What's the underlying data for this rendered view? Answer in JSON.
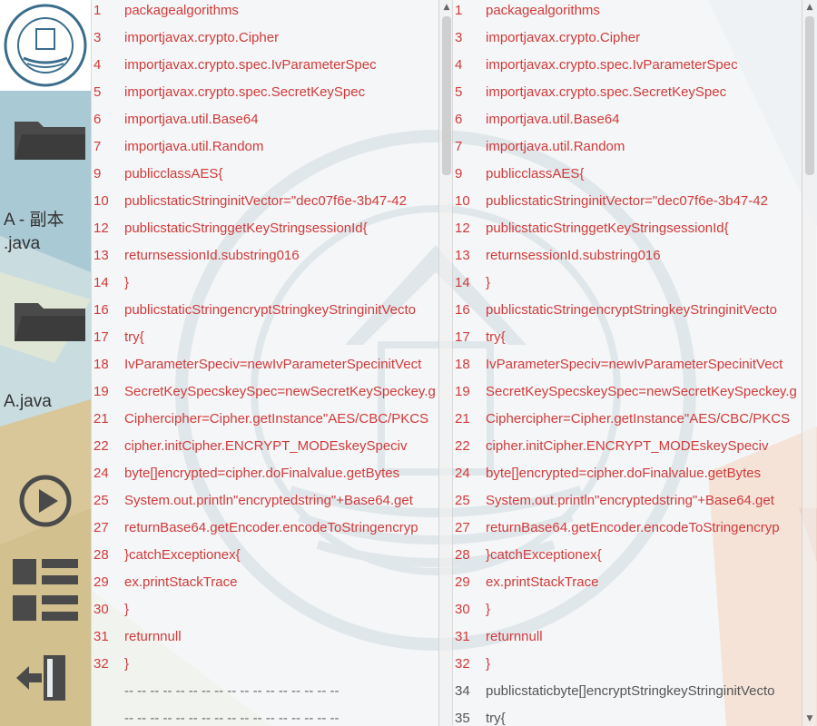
{
  "sidebar": {
    "files": [
      {
        "label_line1": "A - 副本",
        "label_line2": ".java",
        "icon": "folder-icon"
      },
      {
        "label_line1": "A.java",
        "label_line2": "",
        "icon": "folder-icon"
      }
    ],
    "tools": [
      {
        "name": "play-icon"
      },
      {
        "name": "list-view-icon"
      },
      {
        "name": "exit-icon"
      }
    ]
  },
  "left_pane": {
    "lines": [
      {
        "n": "1",
        "text": "packagealgorithms",
        "state": "diff"
      },
      {
        "n": "3",
        "text": "importjavax.crypto.Cipher",
        "state": "diff"
      },
      {
        "n": "4",
        "text": "importjavax.crypto.spec.IvParameterSpec",
        "state": "diff"
      },
      {
        "n": "5",
        "text": "importjavax.crypto.spec.SecretKeySpec",
        "state": "diff"
      },
      {
        "n": "6",
        "text": "importjava.util.Base64",
        "state": "diff"
      },
      {
        "n": "7",
        "text": "importjava.util.Random",
        "state": "diff"
      },
      {
        "n": "9",
        "text": "publicclassAES{",
        "state": "diff"
      },
      {
        "n": "10",
        "text": "publicstaticStringinitVector=\"dec07f6e-3b47-42",
        "state": "diff"
      },
      {
        "n": "12",
        "text": "publicstaticStringgetKeyStringsessionId{",
        "state": "diff"
      },
      {
        "n": "13",
        "text": "returnsessionId.substring016",
        "state": "diff"
      },
      {
        "n": "14",
        "text": "}",
        "state": "diff"
      },
      {
        "n": "16",
        "text": "publicstaticStringencryptStringkeyStringinitVecto",
        "state": "diff"
      },
      {
        "n": "17",
        "text": "try{",
        "state": "diff"
      },
      {
        "n": "18",
        "text": "IvParameterSpeciv=newIvParameterSpecinitVect",
        "state": "diff"
      },
      {
        "n": "19",
        "text": "SecretKeySpecskeySpec=newSecretKeySpeckey.g",
        "state": "diff"
      },
      {
        "n": "21",
        "text": "Ciphercipher=Cipher.getInstance\"AES/CBC/PKCS",
        "state": "diff"
      },
      {
        "n": "22",
        "text": "cipher.initCipher.ENCRYPT_MODEskeySpeciv",
        "state": "diff"
      },
      {
        "n": "24",
        "text": "byte[]encrypted=cipher.doFinalvalue.getBytes",
        "state": "diff"
      },
      {
        "n": "25",
        "text": "System.out.println\"encryptedstring\"+Base64.get",
        "state": "diff"
      },
      {
        "n": "27",
        "text": "returnBase64.getEncoder.encodeToStringencryp",
        "state": "diff"
      },
      {
        "n": "28",
        "text": "}catchExceptionex{",
        "state": "diff"
      },
      {
        "n": "29",
        "text": "ex.printStackTrace",
        "state": "diff"
      },
      {
        "n": "30",
        "text": "}",
        "state": "diff"
      },
      {
        "n": "31",
        "text": "returnnull",
        "state": "diff"
      },
      {
        "n": "32",
        "text": "}",
        "state": "diff"
      },
      {
        "n": "",
        "text": "-- -- -- -- -- -- -- -- -- -- -- -- -- -- -- -- --",
        "state": "sep"
      },
      {
        "n": "",
        "text": "-- -- -- -- -- -- -- -- -- -- -- -- -- -- -- -- --",
        "state": "sep"
      }
    ]
  },
  "right_pane": {
    "lines": [
      {
        "n": "1",
        "text": "packagealgorithms",
        "state": "diff"
      },
      {
        "n": "3",
        "text": "importjavax.crypto.Cipher",
        "state": "diff"
      },
      {
        "n": "4",
        "text": "importjavax.crypto.spec.IvParameterSpec",
        "state": "diff"
      },
      {
        "n": "5",
        "text": "importjavax.crypto.spec.SecretKeySpec",
        "state": "diff"
      },
      {
        "n": "6",
        "text": "importjava.util.Base64",
        "state": "diff"
      },
      {
        "n": "7",
        "text": "importjava.util.Random",
        "state": "diff"
      },
      {
        "n": "9",
        "text": "publicclassAES{",
        "state": "diff"
      },
      {
        "n": "10",
        "text": "publicstaticStringinitVector=\"dec07f6e-3b47-42",
        "state": "diff"
      },
      {
        "n": "12",
        "text": "publicstaticStringgetKeyStringsessionId{",
        "state": "diff"
      },
      {
        "n": "13",
        "text": "returnsessionId.substring016",
        "state": "diff"
      },
      {
        "n": "14",
        "text": "}",
        "state": "diff"
      },
      {
        "n": "16",
        "text": "publicstaticStringencryptStringkeyStringinitVecto",
        "state": "diff"
      },
      {
        "n": "17",
        "text": "try{",
        "state": "diff"
      },
      {
        "n": "18",
        "text": "IvParameterSpeciv=newIvParameterSpecinitVect",
        "state": "diff"
      },
      {
        "n": "19",
        "text": "SecretKeySpecskeySpec=newSecretKeySpeckey.g",
        "state": "diff"
      },
      {
        "n": "21",
        "text": "Ciphercipher=Cipher.getInstance\"AES/CBC/PKCS",
        "state": "diff"
      },
      {
        "n": "22",
        "text": "cipher.initCipher.ENCRYPT_MODEskeySpeciv",
        "state": "diff"
      },
      {
        "n": "24",
        "text": "byte[]encrypted=cipher.doFinalvalue.getBytes",
        "state": "diff"
      },
      {
        "n": "25",
        "text": "System.out.println\"encryptedstring\"+Base64.get",
        "state": "diff"
      },
      {
        "n": "27",
        "text": "returnBase64.getEncoder.encodeToStringencryp",
        "state": "diff"
      },
      {
        "n": "28",
        "text": "}catchExceptionex{",
        "state": "diff"
      },
      {
        "n": "29",
        "text": "ex.printStackTrace",
        "state": "diff"
      },
      {
        "n": "30",
        "text": "}",
        "state": "diff"
      },
      {
        "n": "31",
        "text": "returnnull",
        "state": "diff"
      },
      {
        "n": "32",
        "text": "}",
        "state": "diff"
      },
      {
        "n": "34",
        "text": "publicstaticbyte[]encryptStringkeyStringinitVecto",
        "state": "same"
      },
      {
        "n": "35",
        "text": "try{",
        "state": "same"
      }
    ]
  },
  "colors": {
    "diff_text": "#d23a3a",
    "same_text": "#555555",
    "icon_gray": "#4a4a4a"
  }
}
